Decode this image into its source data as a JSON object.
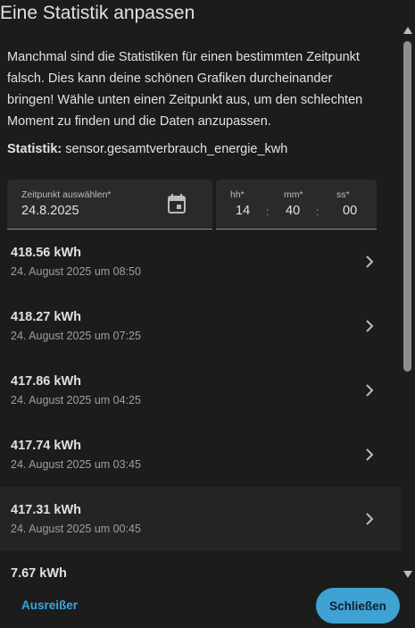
{
  "dialog": {
    "title": "Eine Statistik anpassen",
    "description": "Manchmal sind die Statistiken für einen bestimmten Zeitpunkt falsch. Dies kann deine schönen Grafiken durcheinander bringen! Wähle unten einen Zeitpunkt aus, um den schlechten Moment zu finden und die Daten anzupassen.",
    "statistic_label": "Statistik:",
    "statistic_value": "sensor.gesamtverbrauch_energie_kwh"
  },
  "date_picker": {
    "label": "Zeitpunkt auswählen*",
    "value": "24.8.2025",
    "icon": "calendar-icon"
  },
  "time_picker": {
    "hours_label": "hh*",
    "minutes_label": "mm*",
    "seconds_label": "ss*",
    "hours": "14",
    "minutes": "40",
    "seconds": "00",
    "separator": ":"
  },
  "entries": [
    {
      "value": "418.56 kWh",
      "time": "24. August 2025 um 08:50"
    },
    {
      "value": "418.27 kWh",
      "time": "24. August 2025 um 07:25"
    },
    {
      "value": "417.86 kWh",
      "time": "24. August 2025 um 04:25"
    },
    {
      "value": "417.74 kWh",
      "time": "24. August 2025 um 03:45"
    },
    {
      "value": "417.31 kWh",
      "time": "24. August 2025 um 00:45"
    },
    {
      "value": "7.67 kWh",
      "time": ""
    }
  ],
  "footer": {
    "left_button": "Ausreißer",
    "right_button": "Schließen"
  },
  "colors": {
    "background": "#1c1c1c",
    "accent": "#3ba6e3",
    "primary_button": "#3fa2d2"
  }
}
